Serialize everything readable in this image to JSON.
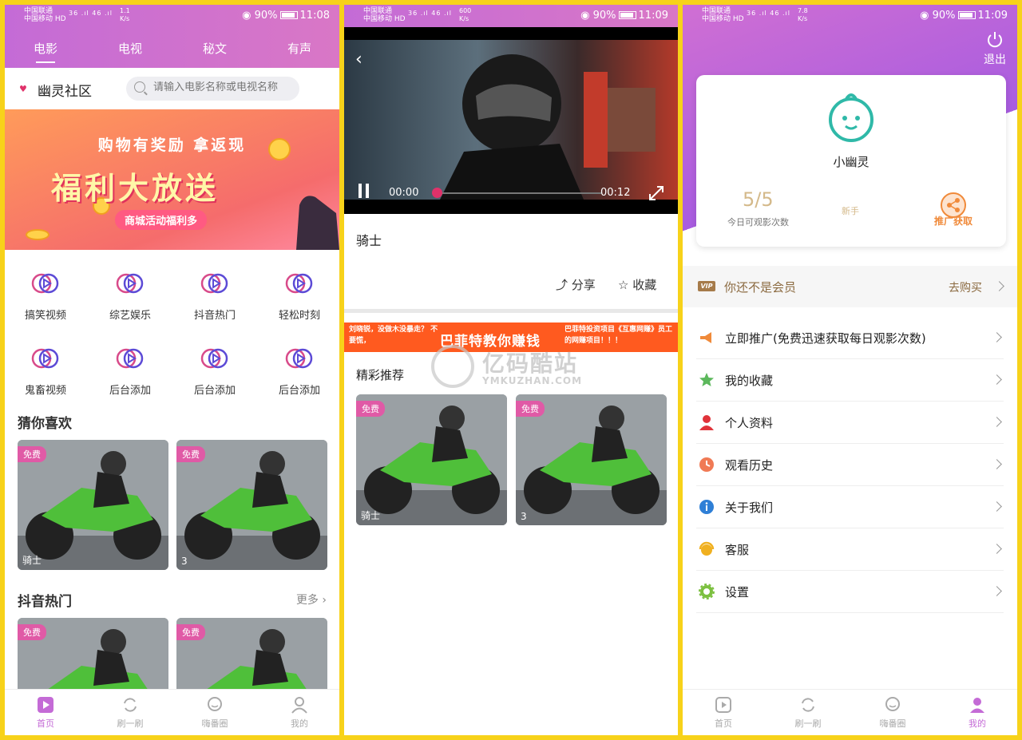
{
  "status_bar": {
    "carrier1": "中国联通",
    "carrier2": "中国移动",
    "hd": "HD",
    "signal": "36 .ıl 46 .ıl",
    "battery": "90%",
    "screens": [
      {
        "speed": "1.1",
        "unit": "K/s",
        "time": "11:08"
      },
      {
        "speed": "600",
        "unit": "K/s",
        "time": "11:09"
      },
      {
        "speed": "7.8",
        "unit": "K/s",
        "time": "11:09"
      }
    ]
  },
  "home": {
    "tabs": [
      "电影",
      "电视",
      "秘文",
      "有声"
    ],
    "active_tab": 0,
    "brand": "幽灵社区",
    "search_placeholder": "请输入电影名称或电视名称",
    "banner": {
      "line1": "购物有奖励 拿返现",
      "line2": "福利大放送",
      "line3": "商城活动福利多"
    },
    "categories": [
      "搞笑视频",
      "综艺娱乐",
      "抖音热门",
      "轻松时刻",
      "鬼畜视频",
      "后台添加",
      "后台添加",
      "后台添加"
    ],
    "section1": "猜你喜欢",
    "section1_items": [
      {
        "badge": "免费",
        "caption": "骑士"
      },
      {
        "badge": "免费",
        "caption": "3"
      }
    ],
    "section2": "抖音热门",
    "more": "更多",
    "section2_items": [
      {
        "badge": "免费",
        "caption": ""
      },
      {
        "badge": "免费",
        "caption": ""
      }
    ]
  },
  "tabbar": {
    "items": [
      "首页",
      "刷一刷",
      "嗨番圈",
      "我的"
    ]
  },
  "player": {
    "time_current": "00:00",
    "time_total": "00:12",
    "progress": 0.0,
    "title": "骑士",
    "share": "分享",
    "collect": "收藏",
    "ad_left": "刘晓锐，没做木没暴走？ 不要慌，",
    "ad_mid": "巴菲特教你赚钱",
    "ad_right": "巴菲特投资项目《互惠网赚》员工的网赚项目！！！",
    "section": "精彩推荐",
    "items": [
      {
        "badge": "免费",
        "caption": "骑士"
      },
      {
        "badge": "免费",
        "caption": "3"
      }
    ]
  },
  "watermark": {
    "title": "亿码酷站",
    "subtitle": "YMKUZHAN.COM"
  },
  "profile": {
    "logout": "退出",
    "username": "小幽灵",
    "views": "5/5",
    "views_label": "今日可观影次数",
    "rank": "新手",
    "promo": "推广获取",
    "vip_badge": "VIP",
    "vip_text": "你还不是会员",
    "vip_buy": "去购买",
    "menu": [
      {
        "label": "立即推广(免费迅速获取每日观影次数)",
        "icon": "megaphone-icon",
        "color": "#f08a3a"
      },
      {
        "label": "我的收藏",
        "icon": "star-icon",
        "color": "#5cb85c"
      },
      {
        "label": "个人资料",
        "icon": "user-icon",
        "color": "#e0333a"
      },
      {
        "label": "观看历史",
        "icon": "clock-icon",
        "color": "#f07a55"
      },
      {
        "label": "关于我们",
        "icon": "info-icon",
        "color": "#2f7fd6"
      },
      {
        "label": "客服",
        "icon": "headset-icon",
        "color": "#f0b020"
      },
      {
        "label": "设置",
        "icon": "gear-icon",
        "color": "#7cc040"
      }
    ]
  },
  "colors": {
    "accent": "#c46bd6",
    "badge": "#e05aa6",
    "frame": "#f7d21a",
    "gold": "#d4b98a"
  }
}
